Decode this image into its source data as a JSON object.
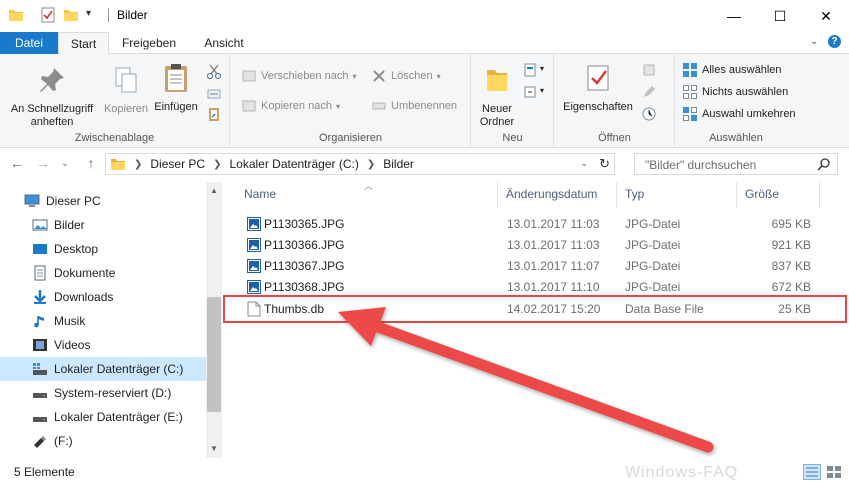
{
  "window": {
    "title": "Bilder",
    "minimize": "—",
    "maximize": "☐",
    "close": "✕"
  },
  "tabs": {
    "file": "Datei",
    "items": [
      "Start",
      "Freigeben",
      "Ansicht"
    ]
  },
  "ribbon": {
    "clipboard": {
      "pin_label": "An Schnellzugriff anheften",
      "copy_label": "Kopieren",
      "paste_label": "Einfügen",
      "group_label": "Zwischenablage"
    },
    "organize": {
      "move_label": "Verschieben nach",
      "copyto_label": "Kopieren nach",
      "delete_label": "Löschen",
      "rename_label": "Umbenennen",
      "group_label": "Organisieren"
    },
    "new": {
      "new_folder_label": "Neuer Ordner",
      "group_label": "Neu"
    },
    "open": {
      "properties_label": "Eigenschaften",
      "group_label": "Öffnen"
    },
    "select": {
      "select_all": "Alles auswählen",
      "select_none": "Nichts auswählen",
      "invert": "Auswahl umkehren",
      "group_label": "Auswählen"
    }
  },
  "address": {
    "crumbs": [
      "Dieser PC",
      "Lokaler Datenträger (C:)",
      "Bilder"
    ],
    "search_placeholder": "\"Bilder\" durchsuchen"
  },
  "navpane": {
    "items": [
      {
        "label": "Dieser PC",
        "icon": "pc-icon"
      },
      {
        "label": "Bilder",
        "icon": "pictures-icon"
      },
      {
        "label": "Desktop",
        "icon": "desktop-icon"
      },
      {
        "label": "Dokumente",
        "icon": "documents-icon"
      },
      {
        "label": "Downloads",
        "icon": "downloads-icon"
      },
      {
        "label": "Musik",
        "icon": "music-icon"
      },
      {
        "label": "Videos",
        "icon": "videos-icon"
      },
      {
        "label": "Lokaler Datenträger (C:)",
        "icon": "drive-icon"
      },
      {
        "label": "System-reserviert (D:)",
        "icon": "drive-icon"
      },
      {
        "label": "Lokaler Datenträger (E:)",
        "icon": "drive-icon"
      },
      {
        "label": "(F:)",
        "icon": "usb-drive-icon"
      }
    ]
  },
  "filelist": {
    "columns": [
      "Name",
      "Änderungsdatum",
      "Typ",
      "Größe"
    ],
    "rows": [
      {
        "name": "P1130365.JPG",
        "date": "13.01.2017 11:03",
        "type": "JPG-Datei",
        "size": "695 KB"
      },
      {
        "name": "P1130366.JPG",
        "date": "13.01.2017 11:03",
        "type": "JPG-Datei",
        "size": "921 KB"
      },
      {
        "name": "P1130367.JPG",
        "date": "13.01.2017 11:07",
        "type": "JPG-Datei",
        "size": "837 KB"
      },
      {
        "name": "P1130368.JPG",
        "date": "13.01.2017 11:10",
        "type": "JPG-Datei",
        "size": "672 KB"
      },
      {
        "name": "Thumbs.db",
        "date": "14.02.2017 15:20",
        "type": "Data Base File",
        "size": "25 KB"
      }
    ]
  },
  "status": {
    "count": "5 Elemente",
    "watermark": "Windows-FAQ"
  },
  "colors": {
    "accent": "#1979ca",
    "selected": "#cce8ff",
    "highlight": "#e84545"
  }
}
